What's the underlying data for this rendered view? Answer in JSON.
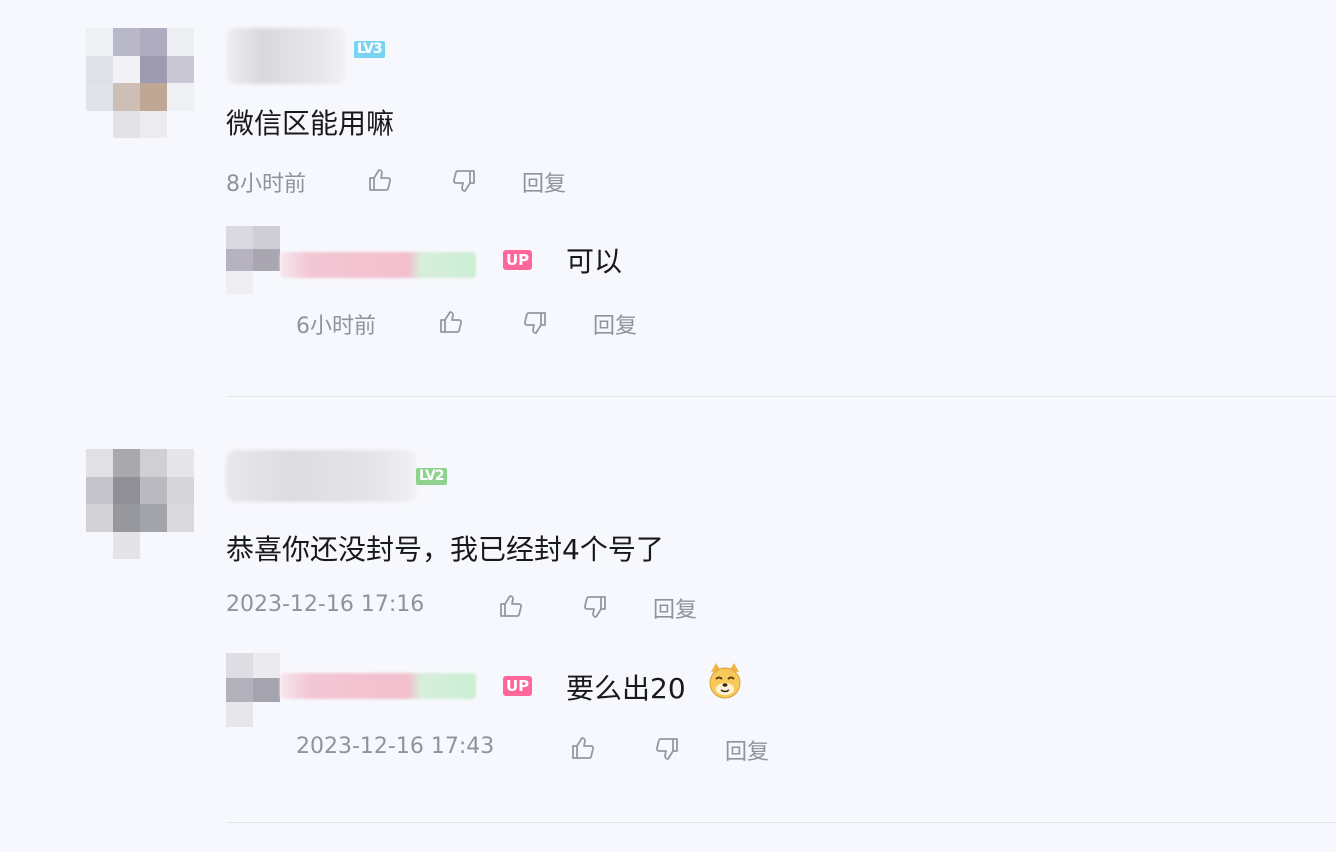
{
  "comments": [
    {
      "level_badge": "LV3",
      "text": "微信区能用嘛",
      "time": "8小时前",
      "reply_label": "回复",
      "reply": {
        "badge": "UP",
        "text": "可以",
        "time": "6小时前",
        "reply_label": "回复"
      }
    },
    {
      "level_badge": "LV2",
      "text": "恭喜你还没封号，我已经封4个号了",
      "time": "2023-12-16 17:16",
      "reply_label": "回复",
      "reply": {
        "badge": "UP",
        "text": "要么出20",
        "emoji": "doge-emoji",
        "time": "2023-12-16 17:43",
        "reply_label": "回复"
      }
    }
  ],
  "icons": {
    "like": "thumb-up-icon",
    "dislike": "thumb-down-icon"
  },
  "colors": {
    "background": "#f7f8fd",
    "meta_text": "#8f939a",
    "up_badge": "#ff6699",
    "lv3_badge": "#7ad3f2",
    "lv2_badge": "#8fd28e"
  }
}
